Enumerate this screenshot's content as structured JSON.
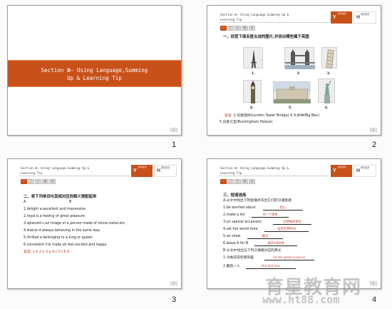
{
  "slides": [
    {
      "number": "1",
      "title_line1": "Section Ⅲ— Using Language,Summing",
      "title_line2": "Up & Learning Tip"
    },
    {
      "number": "2",
      "header_line1": "Section Ⅲ— Using Language,Summing Up &",
      "header_line2": "Learning Tip",
      "heading": "一、欣赏下面名胜古迹的图片,并说出哪些属于英国",
      "photo_labels": [
        "1.",
        "2.",
        "3.",
        "4.",
        "5.",
        "6."
      ],
      "answer_label": "答案:",
      "answer_line1": "2.伦敦塔桥(London Tower Bridge)  4.大本钟(Big Ben)",
      "answer_line2": "5.白金汉宫(Buckingham Palace)"
    },
    {
      "number": "3",
      "header_line1": "Section Ⅲ— Using Language,Summing Up &",
      "header_line2": "Learning Tip",
      "heading": "二、将下列单词与其相对应的释义搭配起来",
      "col_a": "A",
      "col_b": "B",
      "items": [
        "1.delight      a.excellent and impressive",
        "2.royal         b.a feeling of great pleasure",
        "3.splendid     c.an image of a person made of stone,metal,etc.",
        "4.statue         d.always behaving in the same way",
        "5.thrilled       e.belonging to a king or queen",
        "6.consistent   f.to make sb feel excited and happy"
      ],
      "answer_label": "答案:",
      "answer": "1.b  2.e  3.a  4.c  5.f  6.d"
    },
    {
      "number": "4",
      "header_line1": "Section Ⅲ— Using Language,Summing Up &",
      "header_line2": "Learning Tip",
      "heading": "三、短语选择",
      "part_a": "A.从文中找出下列短语并写出它们的汉语意思",
      "phrases": [
        {
          "text": "1.be worried about",
          "answer": "担心"
        },
        {
          "text": "2.make a list",
          "answer": "列一个清单"
        },
        {
          "text": "3.on special occasions",
          "answer": "在特殊的场合"
        },
        {
          "text": "4.set the world time",
          "answer": "设定世界时间"
        },
        {
          "text": "5.on show",
          "answer": "展出"
        },
        {
          "text": "6.leave A for B",
          "answer": "离开A去B地"
        }
      ],
      "part_b": "B.从文中找出与下列汉语相对应的英文",
      "b_items": [
        {
          "text": "1.令她非常吃惊的是",
          "answer": "to her great surprise"
        },
        {
          "text": "2.最后一人",
          "answer": "the last one"
        }
      ]
    }
  ],
  "tab_labels": [
    "一",
    "二",
    "三",
    "四",
    "五"
  ],
  "logo_primary": "Y",
  "logo_primary_sub": "志鸿优化",
  "logo_secondary": "H",
  "logo_secondary_sub": "優化設計",
  "watermark_cn": "育星教育网",
  "watermark_url": "www.ht88.com",
  "page_button_glyph": "▸"
}
